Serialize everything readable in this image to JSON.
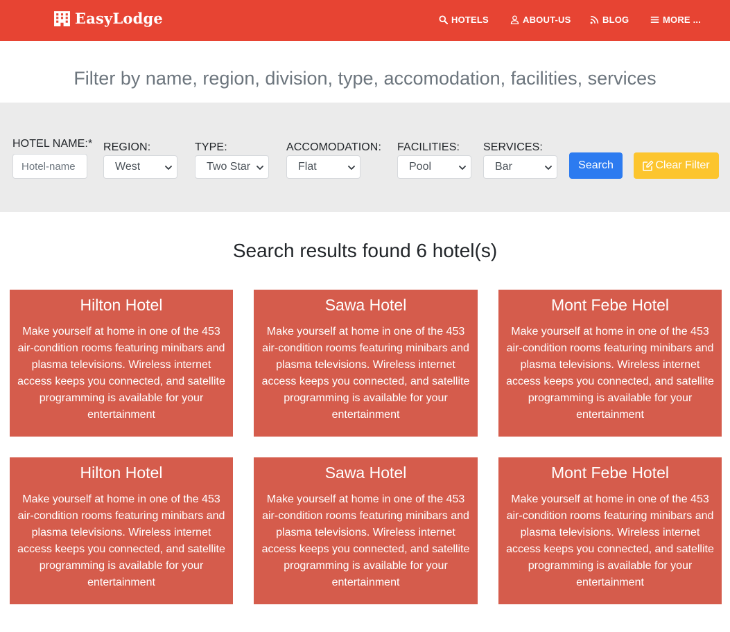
{
  "brand": {
    "name": "EasyLodge",
    "icon": "hotel-building-icon"
  },
  "nav": [
    {
      "label": "HOTELS",
      "icon": "search-icon"
    },
    {
      "label": "ABOUT-US",
      "icon": "user-icon"
    },
    {
      "label": "BLOG",
      "icon": "rss-icon"
    },
    {
      "label": "MORE ...",
      "icon": "menu-bars-icon"
    }
  ],
  "filter": {
    "heading": "Filter by name, region, division, type, accomodation, facilities, services",
    "hotel_name": {
      "label": "HOTEL NAME:*",
      "placeholder": "Hotel-name"
    },
    "region": {
      "label": "REGION:",
      "value": "West"
    },
    "type": {
      "label": "TYPE:",
      "value": "Two Star"
    },
    "accomodation": {
      "label": "ACCOMODATION:",
      "value": "Flat"
    },
    "facilities": {
      "label": "FACILITIES:",
      "value": "Pool"
    },
    "services": {
      "label": "SERVICES:",
      "value": "Bar"
    },
    "search_label": "Search",
    "clear_label": "Clear Filter"
  },
  "colors": {
    "navbar": "#e74433",
    "card": "#d55c4c",
    "search": "#2c7bf0",
    "clear": "#fcc52e"
  },
  "results": {
    "heading": "Search results found 6 hotel(s)",
    "hotels": [
      {
        "name": "Hilton Hotel",
        "description": "Make yourself at home in one of the 453 air-condition rooms featuring minibars and plasma televisions. Wireless internet access keeps you connected, and satellite programming is available for your entertainment"
      },
      {
        "name": "Sawa Hotel",
        "description": "Make yourself at home in one of the 453 air-condition rooms featuring minibars and plasma televisions. Wireless internet access keeps you connected, and satellite programming is available for your entertainment"
      },
      {
        "name": "Mont Febe Hotel",
        "description": "Make yourself at home in one of the 453 air-condition rooms featuring minibars and plasma televisions. Wireless internet access keeps you connected, and satellite programming is available for your entertainment"
      },
      {
        "name": "Hilton Hotel",
        "description": "Make yourself at home in one of the 453 air-condition rooms featuring minibars and plasma televisions. Wireless internet access keeps you connected, and satellite programming is available for your entertainment"
      },
      {
        "name": "Sawa Hotel",
        "description": "Make yourself at home in one of the 453 air-condition rooms featuring minibars and plasma televisions. Wireless internet access keeps you connected, and satellite programming is available for your entertainment"
      },
      {
        "name": "Mont Febe Hotel",
        "description": "Make yourself at home in one of the 453 air-condition rooms featuring minibars and plasma televisions. Wireless internet access keeps you connected, and satellite programming is available for your entertainment"
      }
    ]
  }
}
